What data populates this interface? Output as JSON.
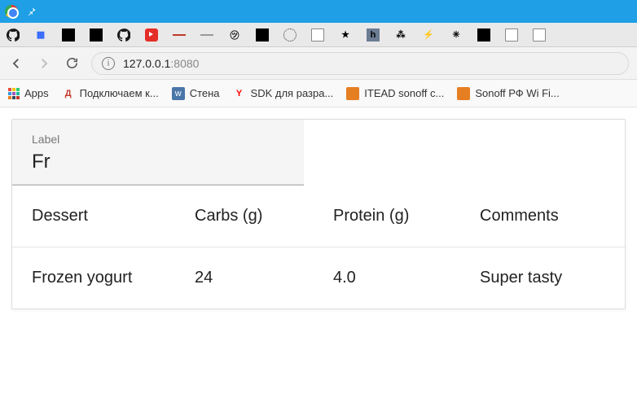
{
  "address": {
    "host": "127.0.0.1",
    "port": ":8080"
  },
  "bookmarks": {
    "apps": "Apps",
    "b1": "Подключаем к...",
    "b2": "Стена",
    "b3": "SDK для разра...",
    "b4": "ITEAD sonoff с...",
    "b5": "Sonoff РФ Wi Fi..."
  },
  "filter": {
    "label": "Label",
    "value": "Fr"
  },
  "table": {
    "headers": {
      "c1": "Dessert",
      "c2": "Carbs (g)",
      "c3": "Protein (g)",
      "c4": "Comments"
    },
    "row1": {
      "c1": "Frozen yogurt",
      "c2": "24",
      "c3": "4.0",
      "c4": "Super tasty"
    }
  }
}
